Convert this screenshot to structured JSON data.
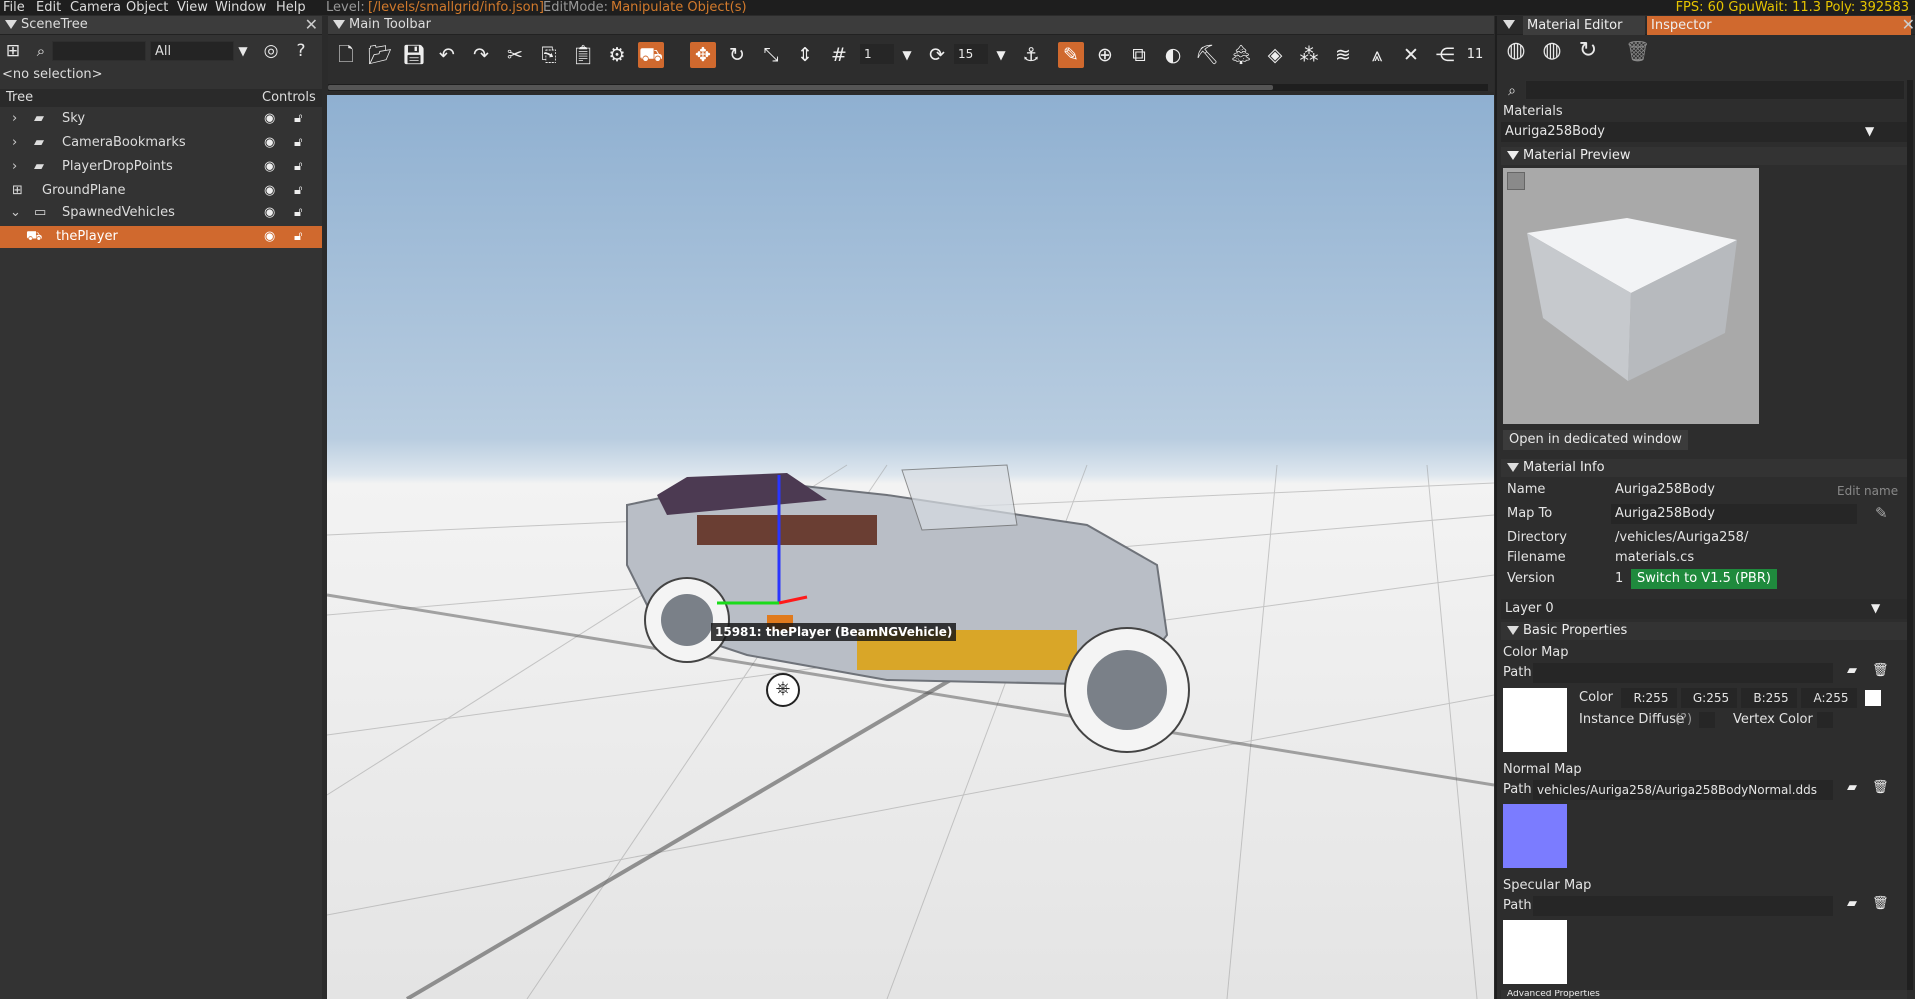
{
  "menubar": {
    "items": [
      "File",
      "Edit",
      "Camera",
      "Object",
      "View",
      "Window",
      "Help"
    ],
    "level_label": "Level:",
    "level_value": "[/levels/smallgrid/info.json]",
    "editmode_label": "EditMode:",
    "editmode_value": "Manipulate Object(s)",
    "stats": "FPS: 60  GpuWait: 11.3  Poly: 392583"
  },
  "scenetree": {
    "title": "SceneTree",
    "filter_value": "All",
    "selection": "<no selection>",
    "col_tree": "Tree",
    "col_controls": "Controls",
    "items": [
      {
        "label": "Sky",
        "icon": "folder-icon",
        "expandable": true
      },
      {
        "label": "CameraBookmarks",
        "icon": "folder-icon",
        "expandable": true
      },
      {
        "label": "PlayerDropPoints",
        "icon": "folder-icon",
        "expandable": true
      },
      {
        "label": "GroundPlane",
        "icon": "grid-icon",
        "expandable": false
      },
      {
        "label": "SpawnedVehicles",
        "icon": "folder-outline-icon",
        "expandable": true,
        "expanded": true
      },
      {
        "label": "thePlayer",
        "icon": "car-icon",
        "expandable": false,
        "selected": true
      }
    ]
  },
  "maintoolbar": {
    "title": "Main Toolbar",
    "snap_value": "1",
    "rotate_snap_value": "15",
    "overflow_value": "11"
  },
  "viewport": {
    "object_label": "15981: thePlayer (BeamNGVehicle)"
  },
  "rightpanel": {
    "tab_material_editor": "Material Editor",
    "tab_inspector": "Inspector",
    "materials_label": "Materials",
    "material_selected": "Auriga258Body",
    "preview_section": "Material Preview",
    "open_window_button": "Open in dedicated window",
    "info_section": "Material Info",
    "name_label": "Name",
    "name_value": "Auriga258Body",
    "edit_name": "Edit name",
    "mapto_label": "Map To",
    "mapto_value": "Auriga258Body",
    "directory_label": "Directory",
    "directory_value": "/vehicles/Auriga258/",
    "filename_label": "Filename",
    "filename_value": "materials.cs",
    "version_label": "Version",
    "version_value": "1",
    "switch_button": "Switch to V1.5 (PBR)",
    "layer_value": "Layer 0",
    "basic_section": "Basic Properties",
    "color_map_label": "Color Map",
    "path_label": "Path",
    "color_label": "Color",
    "r_value": "R:255",
    "g_value": "G:255",
    "b_value": "B:255",
    "a_value": "A:255",
    "instance_diffuse": "Instance Diffuse",
    "help_q": "(?)",
    "vertex_color": "Vertex Color",
    "normal_map_label": "Normal Map",
    "normal_path_value": "vehicles/Auriga258/Auriga258BodyNormal.dds",
    "specular_map_label": "Specular Map",
    "advanced_section": "Advanced Properties"
  },
  "colors": {
    "accent": "#d0692e",
    "green_button": "#1f8a3d",
    "normal_swatch": "#7b7cff"
  }
}
